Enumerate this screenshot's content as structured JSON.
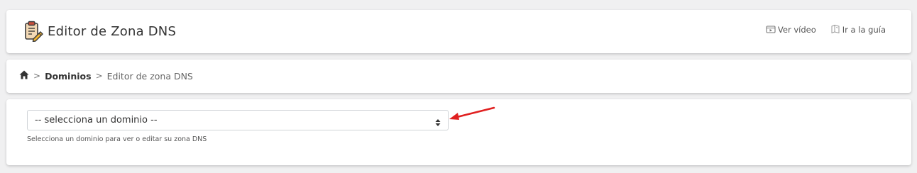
{
  "header": {
    "title": "Editor de Zona DNS",
    "title_icon": "clipboard-pencil-icon",
    "links": [
      {
        "label": "Ver vídeo",
        "icon": "video-icon"
      },
      {
        "label": "Ir a la guía",
        "icon": "book-icon"
      }
    ]
  },
  "breadcrumb": {
    "home_icon": "home-icon",
    "separator": ">",
    "items": [
      "Dominios",
      "Editor de zona DNS"
    ]
  },
  "domain_select": {
    "selected": "-- selecciona un dominio --",
    "help_text": "Selecciona un dominio para ver o editar su zona DNS"
  },
  "annotation": {
    "arrow_color": "#e02020"
  }
}
